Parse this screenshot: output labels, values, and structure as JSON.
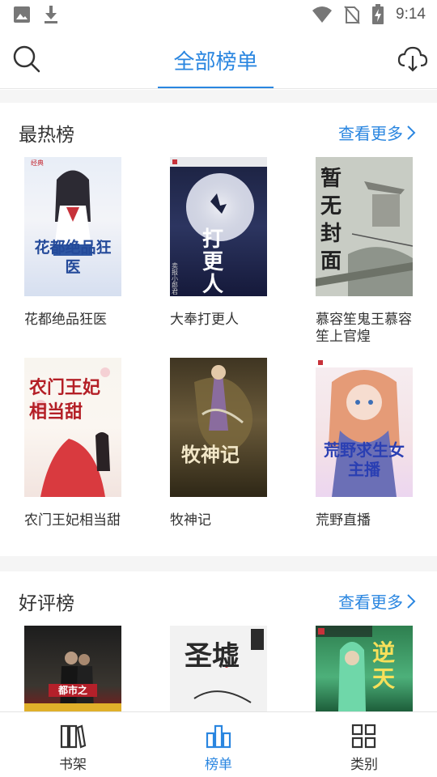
{
  "status_bar": {
    "time": "9:14"
  },
  "header": {
    "title": "全部榜单"
  },
  "sections": [
    {
      "title": "最热榜",
      "more": "查看更多",
      "books": [
        {
          "title": "花都绝品狂医",
          "cover_text": "花都绝品狂医"
        },
        {
          "title": "大奉打更人",
          "cover_text": "打更人"
        },
        {
          "title": "慕容笙鬼王慕容笙上官煌",
          "cover_text": "暂无封面"
        },
        {
          "title": "农门王妃相当甜",
          "cover_text": "农门王妃相当甜"
        },
        {
          "title": "牧神记",
          "cover_text": "牧神记"
        },
        {
          "title": "荒野直播",
          "cover_text": "荒野求生女主播"
        }
      ]
    },
    {
      "title": "好评榜",
      "more": "查看更多",
      "books": [
        {
          "cover_text": "都市之"
        },
        {
          "cover_text": "圣墟"
        },
        {
          "cover_text": "逆天"
        }
      ]
    }
  ],
  "bottom_nav": [
    {
      "label": "书架",
      "icon": "bookshelf-icon"
    },
    {
      "label": "榜单",
      "icon": "chart-bars-icon",
      "active": true
    },
    {
      "label": "类别",
      "icon": "grid-icon"
    }
  ],
  "colors": {
    "accent": "#2a86e0",
    "text": "#333333",
    "divider": "#f5f5f5"
  }
}
